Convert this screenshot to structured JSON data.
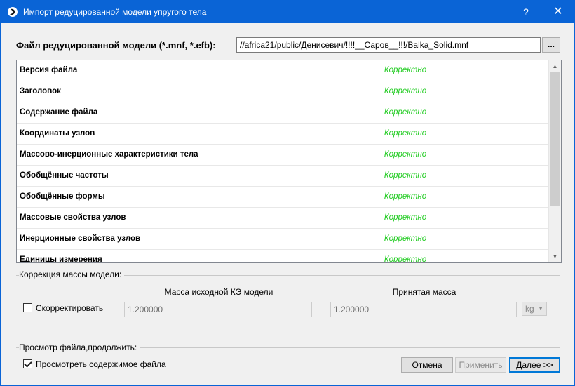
{
  "window": {
    "title": "Импорт редуцированной модели упругого тела",
    "help_label": "?",
    "close_label": "✕"
  },
  "file": {
    "label": "Файл редуцированной модели (*.mnf, *.efb):",
    "path": "//africa21/public/Денисевич/!!!!__Саров__!!!/Balka_Solid.mnf",
    "browse_label": "..."
  },
  "checks": {
    "rows": [
      {
        "name": "Версия файла",
        "status": "Корректно"
      },
      {
        "name": "Заголовок",
        "status": "Корректно"
      },
      {
        "name": "Содержание файла",
        "status": "Корректно"
      },
      {
        "name": "Координаты узлов",
        "status": "Корректно"
      },
      {
        "name": "Массово-инерционные характеристики тела",
        "status": "Корректно"
      },
      {
        "name": "Обобщённые частоты",
        "status": "Корректно"
      },
      {
        "name": "Обобщённые формы",
        "status": "Корректно"
      },
      {
        "name": "Массовые свойства узлов",
        "status": "Корректно"
      },
      {
        "name": "Инерционные свойства узлов",
        "status": "Корректно"
      },
      {
        "name": "Единицы измерения",
        "status": "Корректно"
      }
    ],
    "status_color": "#22cc22"
  },
  "mass": {
    "group_title": "Коррекция массы модели:",
    "correct_label": "Скорректировать",
    "correct_checked": false,
    "original_header": "Масса исходной КЭ модели",
    "original_value": "1.200000",
    "accepted_header": "Принятая масса",
    "accepted_value": "1.200000",
    "unit": "kg"
  },
  "preview": {
    "group_title": "Просмотр файла,продолжить:",
    "view_label": "Просмотреть содержимое файла",
    "view_checked": true
  },
  "buttons": {
    "cancel": "Отмена",
    "apply": "Применить",
    "next": "Далее >>"
  },
  "colors": {
    "titlebar": "#0a64d6",
    "default_button_border": "#0078d7"
  }
}
